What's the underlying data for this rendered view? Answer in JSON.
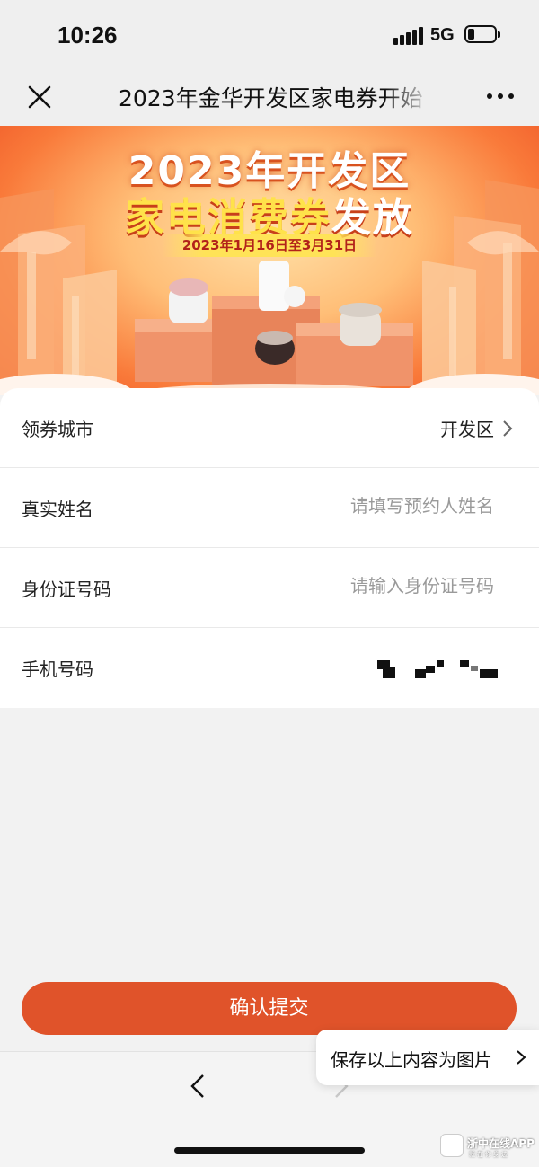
{
  "status_bar": {
    "time": "10:26",
    "network": "5G"
  },
  "nav": {
    "title": "2023年金华开发区家电券开始",
    "close_icon": "close-icon",
    "more_icon": "more-icon"
  },
  "banner": {
    "title_line1": "2023年开发区",
    "title_line2_highlight": "家电消费券",
    "title_line2_rest": "发放",
    "date_range": "2023年1月16日至3月31日"
  },
  "form": {
    "city": {
      "label": "领券城市",
      "value": "开发区"
    },
    "name": {
      "label": "真实姓名",
      "placeholder": "请填写预约人姓名"
    },
    "id_number": {
      "label": "身份证号码",
      "placeholder": "请输入身份证号码"
    },
    "phone": {
      "label": "手机号码"
    }
  },
  "submit_label": "确认提交",
  "save_tooltip": "保存以上内容为图片",
  "watermark": {
    "brand": "浙中在线APP",
    "slogan": "就在你身边"
  },
  "colors": {
    "primary": "#e0532a",
    "banner_orange": "#ee5124",
    "highlight_yellow": "#ffe24a"
  }
}
